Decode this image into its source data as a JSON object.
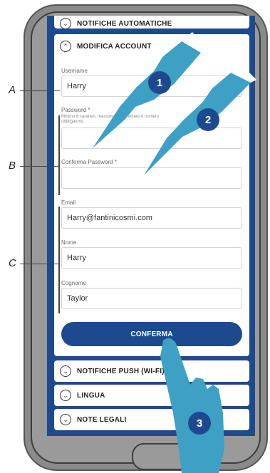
{
  "account_section": {
    "title": "MODIFICA ACCOUNT",
    "username_label": "Username",
    "username_value": "Harry",
    "password_label": "Password *",
    "password_hint": "Minimo 6 caratteri, massimo 20 tra lettere e numero obbligatorio.",
    "confirm_password_label": "Conferma Password *",
    "email_label": "Email",
    "email_value": "Harry@fantinicosmi.com",
    "name_label": "Nome",
    "name_value": "Harry",
    "surname_label": "Cognome",
    "surname_value": "Taylor",
    "confirm_button": "CONFERMA"
  },
  "other_sections": {
    "top_partial": "NOTIFICHE AUTOMATICHE",
    "push_notifications": "NOTIFICHE PUSH (WI-FI)",
    "language": "LINGUA",
    "legal_notes": "NOTE LEGALI"
  },
  "annotations": {
    "a": "A",
    "b": "B",
    "c": "C"
  },
  "steps": {
    "one": "1",
    "two": "2",
    "three": "3"
  },
  "colors": {
    "primary": "#1d4a8f",
    "hand": "#3ea0c4",
    "phone_frame": "#8a8a8a"
  }
}
